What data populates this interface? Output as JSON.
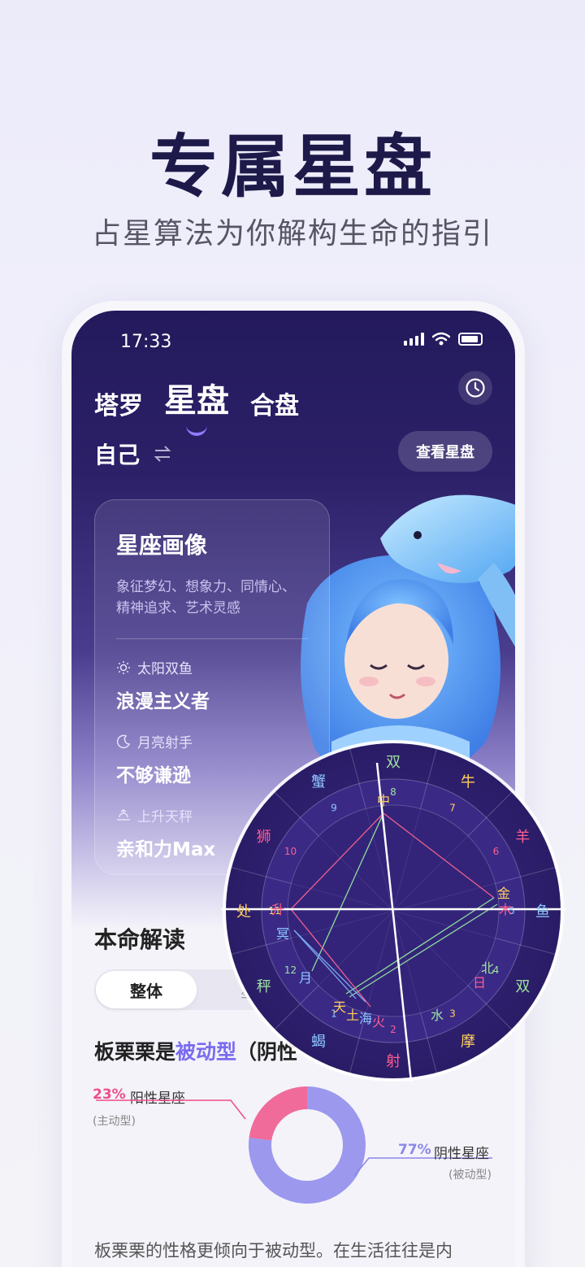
{
  "hero": {
    "title": "专属星盘",
    "subtitle": "占星算法为你解构生命的指引"
  },
  "status_bar": {
    "time": "17:33"
  },
  "tabs": [
    {
      "label": "塔罗",
      "active": false
    },
    {
      "label": "星盘",
      "active": true
    },
    {
      "label": "合盘",
      "active": false
    }
  ],
  "profile": {
    "name": "自己",
    "view_button": "查看星盘"
  },
  "portrait_card": {
    "title": "星座画像",
    "description": "象征梦幻、想象力、同情心、精神追求、艺术灵感",
    "traits": [
      {
        "icon": "sun-icon",
        "label": "太阳双鱼",
        "value": "浪漫主义者"
      },
      {
        "icon": "moon-icon",
        "label": "月亮射手",
        "value": "不够谦逊"
      },
      {
        "icon": "horizon-icon",
        "label": "上升天秤",
        "value": "亲和力Max"
      }
    ]
  },
  "natal": {
    "section_title": "本命解读",
    "segments": [
      "整体",
      "星"
    ],
    "type_prefix": "板栗栗是",
    "type_highlight": "被动型",
    "type_suffix": "（阴性",
    "yang": {
      "percent": "23%",
      "name": "阳性星座",
      "type": "(主动型)"
    },
    "yin": {
      "percent": "77%",
      "name": "阴性星座",
      "type": "(被动型)"
    },
    "donut": {
      "yang_fraction": 0.23,
      "yin_fraction": 0.77,
      "yang_color": "#f06b9a",
      "yin_color": "#9b98ee"
    },
    "bottom_text": "板栗栗的性格更倾向于被动型。在生活往往是内"
  },
  "wheel": {
    "signs": [
      "蟹",
      "双",
      "牛",
      "羊",
      "鱼",
      "双",
      "摩",
      "射",
      "蝎",
      "秤",
      "处",
      "狮"
    ],
    "houses": [
      "9",
      "8",
      "7",
      "6",
      "5",
      "4",
      "3",
      "2",
      "1",
      "12",
      "11",
      "10"
    ],
    "planets": [
      "中",
      "金",
      "木",
      "北",
      "日",
      "水",
      "火",
      "海",
      "土",
      "天",
      "月",
      "冥",
      "升"
    ]
  },
  "colors": {
    "accent": "#7a6cf0",
    "dark_bg": "#231a5c"
  }
}
